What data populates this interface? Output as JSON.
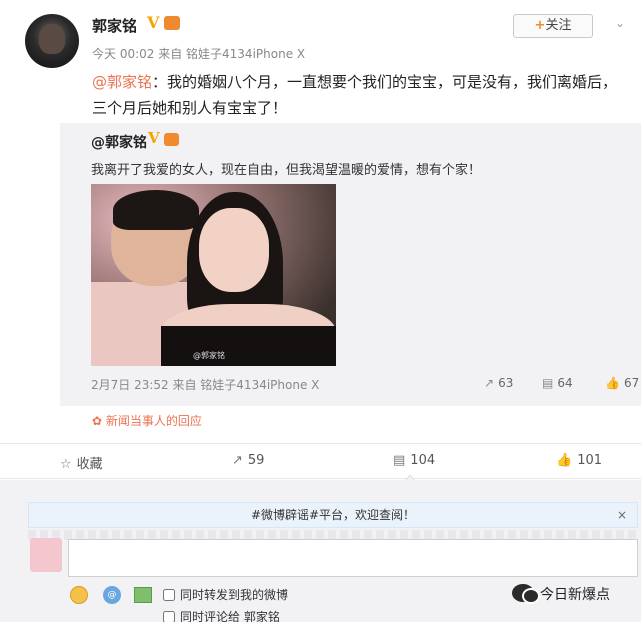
{
  "post": {
    "username": "郭家铭",
    "verified_badge": "V",
    "meta": "今天 00:02 来自 铭娃子4134iPhone X",
    "follow_label": "关注",
    "follow_plus": "+",
    "chevron": "⌄",
    "mention": "@郭家铭",
    "text": "：我的婚姻八个月，一直想要个我们的宝宝，可是没有，我们离婚后，三个月后她和别人有宝宝了！"
  },
  "repost": {
    "username": "@郭家铭",
    "verified_badge": "V",
    "text": "我离开了我爱的女人，现在自由，但我渴望温暖的爱情，想有个家！",
    "photo_watermark": "@郭家铭",
    "meta": "2月7日 23:52 来自 铭娃子4134iPhone X",
    "reposts": "63",
    "comments": "64",
    "likes": "67"
  },
  "news_note": "新闻当事人的回应",
  "actions": {
    "favorite_label": "收藏",
    "repost_count": "59",
    "comment_count": "104",
    "like_count": "101"
  },
  "comment_box": {
    "banner": "#微博辟谣#平台，欢迎查阅！",
    "close": "×",
    "input_value": "",
    "at_icon_text": "@",
    "option_forward": "同时转发到我的微博",
    "option_comment": "同时评论给 郭家铭"
  },
  "source_mark": "今日新爆点",
  "icons": {
    "star": "☆",
    "repost": "↗",
    "comment": "▤",
    "like": "👍",
    "flower": "✿"
  },
  "colors": {
    "accent": "#eb7350",
    "vip_gold": "#f5a300",
    "panel": "#f2f2f5"
  }
}
